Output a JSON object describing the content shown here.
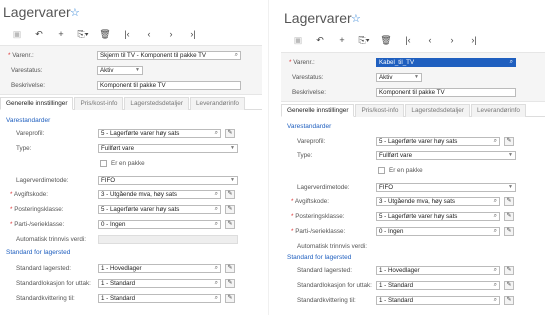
{
  "left": {
    "title": "Lagervarer",
    "header": {
      "varenr_label": "Varenr.:",
      "varenr_value": "Skjerm til TV - Komponent til pakke TV",
      "status_label": "Varestatus:",
      "status_value": "Aktiv",
      "beskrivelse_label": "Beskrivelse:",
      "beskrivelse_value": "Komponent til pakke TV"
    },
    "tabs": [
      "Generelle innstillinger",
      "Pris/kost-info",
      "Lagerstedsdetaljer",
      "Leverandørinfo"
    ],
    "form": {
      "section1": "Varestandarder",
      "vareprofil_label": "Vareprofil:",
      "vareprofil_value": "5 - Lagerførte varer høy sats",
      "type_label": "Type:",
      "type_value": "Fullført vare",
      "pakke_label": "Er en pakke",
      "lagerverdi_label": "Lagerverdimetode:",
      "lagerverdi_value": "FIFO",
      "avgift_label": "Avgiftskode:",
      "avgift_value": "3 - Utgående mva, høy sats",
      "postering_label": "Posteringsklasse:",
      "postering_value": "5 - Lagerførte varer høy sats",
      "parti_label": "Parti-/serieklasse:",
      "parti_value": "0 - Ingen",
      "auto_label": "Automatisk trinnvis verdi:",
      "section2": "Standard for lagersted",
      "lagersted_label": "Standard lagersted:",
      "lagersted_value": "1 - Hovedlager",
      "uttak_label": "Standardlokasjon for uttak:",
      "uttak_value": "1 - Standard",
      "kvittering_label": "Standardkvittering til:",
      "kvittering_value": "1 - Standard"
    }
  },
  "right": {
    "title": "Lagervarer",
    "header": {
      "varenr_label": "Varenr.:",
      "varenr_value": "Kabel_til_TV",
      "status_label": "Varestatus:",
      "status_value": "Aktiv",
      "beskrivelse_label": "Beskrivelse:",
      "beskrivelse_value": "Komponent til pakke TV"
    },
    "tabs": [
      "Generelle innstillinger",
      "Pris/kost-info",
      "Lagerstedsdetaljer",
      "Leverandørinfo"
    ],
    "form": {
      "section1": "Varestandarder",
      "vareprofil_label": "Vareprofil:",
      "vareprofil_value": "5 - Lagerførte varer høy sats",
      "type_label": "Type:",
      "type_value": "Fullført vare",
      "pakke_label": "Er en pakke",
      "lagerverdi_label": "Lagerverdimetode:",
      "lagerverdi_value": "FIFO",
      "avgift_label": "Avgiftskode:",
      "avgift_value": "3 - Utgående mva, høy sats",
      "postering_label": "Posteringsklasse:",
      "postering_value": "5 - Lagerførte varer høy sats",
      "parti_label": "Parti-/serieklasse:",
      "parti_value": "0 - Ingen",
      "auto_label": "Automatisk trinnvis verdi:",
      "section2": "Standard for lagersted",
      "lagersted_label": "Standard lagersted:",
      "lagersted_value": "1 - Hovedlager",
      "uttak_label": "Standardlokasjon for uttak:",
      "uttak_value": "1 - Standard",
      "kvittering_label": "Standardkvittering til:",
      "kvittering_value": "1 - Standard"
    }
  },
  "icons": {
    "star": "star-icon",
    "save": "save-icon",
    "undo": "undo-icon",
    "add": "plus-icon",
    "copy": "copy-icon",
    "delete": "trash-icon",
    "first": "first-icon",
    "prev": "prev-icon",
    "next": "next-icon",
    "last": "last-icon",
    "search": "search-icon",
    "edit": "pencil-icon"
  },
  "colors": {
    "accent": "#1f5fbf",
    "star": "#2a7fd4",
    "selection": "#1f5fbf"
  }
}
